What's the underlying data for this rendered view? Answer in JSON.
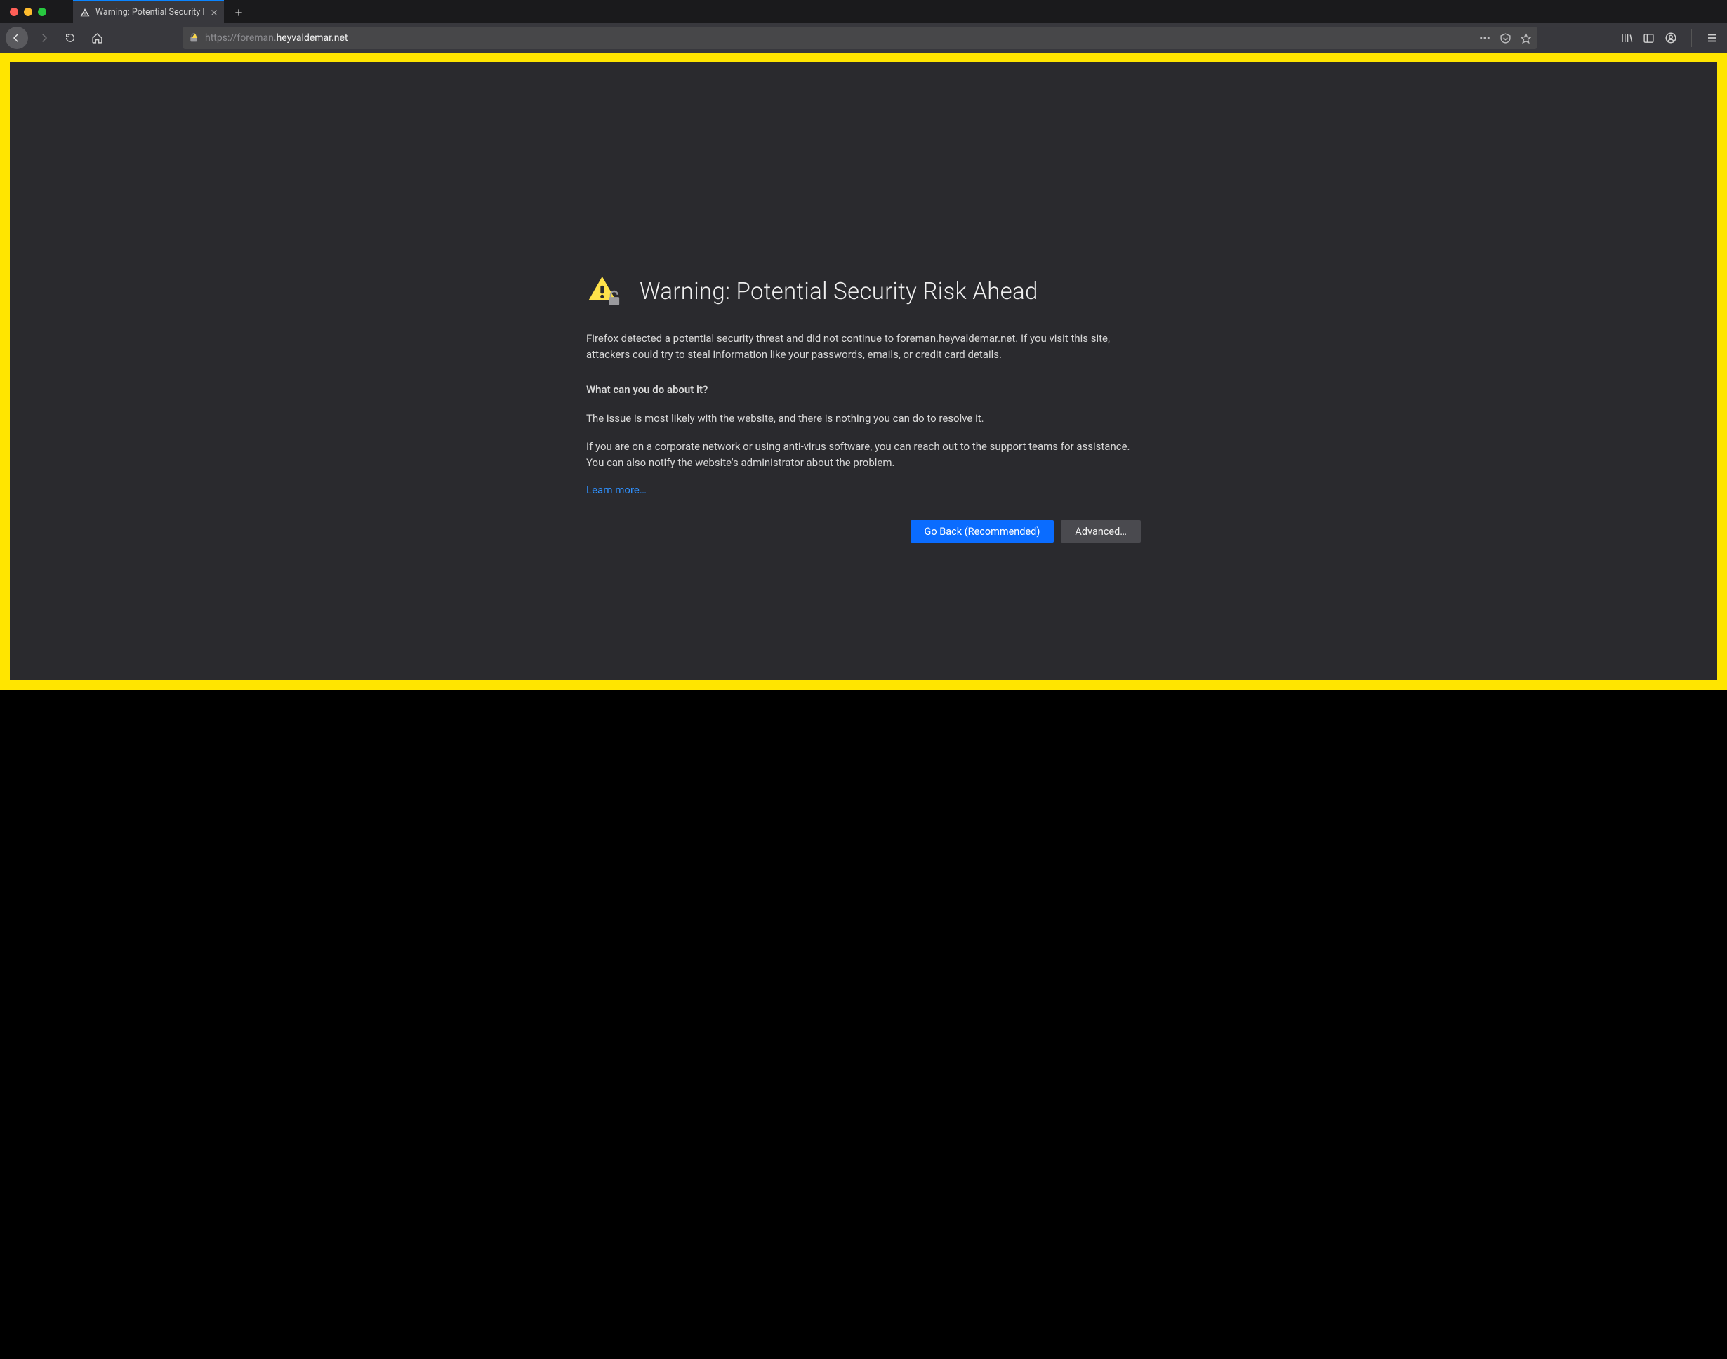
{
  "tab": {
    "title": "Warning: Potential Security Risk"
  },
  "url": {
    "prefix": "https://foreman.",
    "host": "heyvaldemar.net"
  },
  "warning": {
    "title": "Warning: Potential Security Risk Ahead",
    "para1": "Firefox detected a potential security threat and did not continue to foreman.heyvaldemar.net. If you visit this site, attackers could try to steal information like your passwords, emails, or credit card details.",
    "subhead": "What can you do about it?",
    "para2": "The issue is most likely with the website, and there is nothing you can do to resolve it.",
    "para3": "If you are on a corporate network or using anti-virus software, you can reach out to the support teams for assistance. You can also notify the website's administrator about the problem.",
    "learn_more": "Learn more…",
    "go_back": "Go Back (Recommended)",
    "advanced": "Advanced…"
  }
}
